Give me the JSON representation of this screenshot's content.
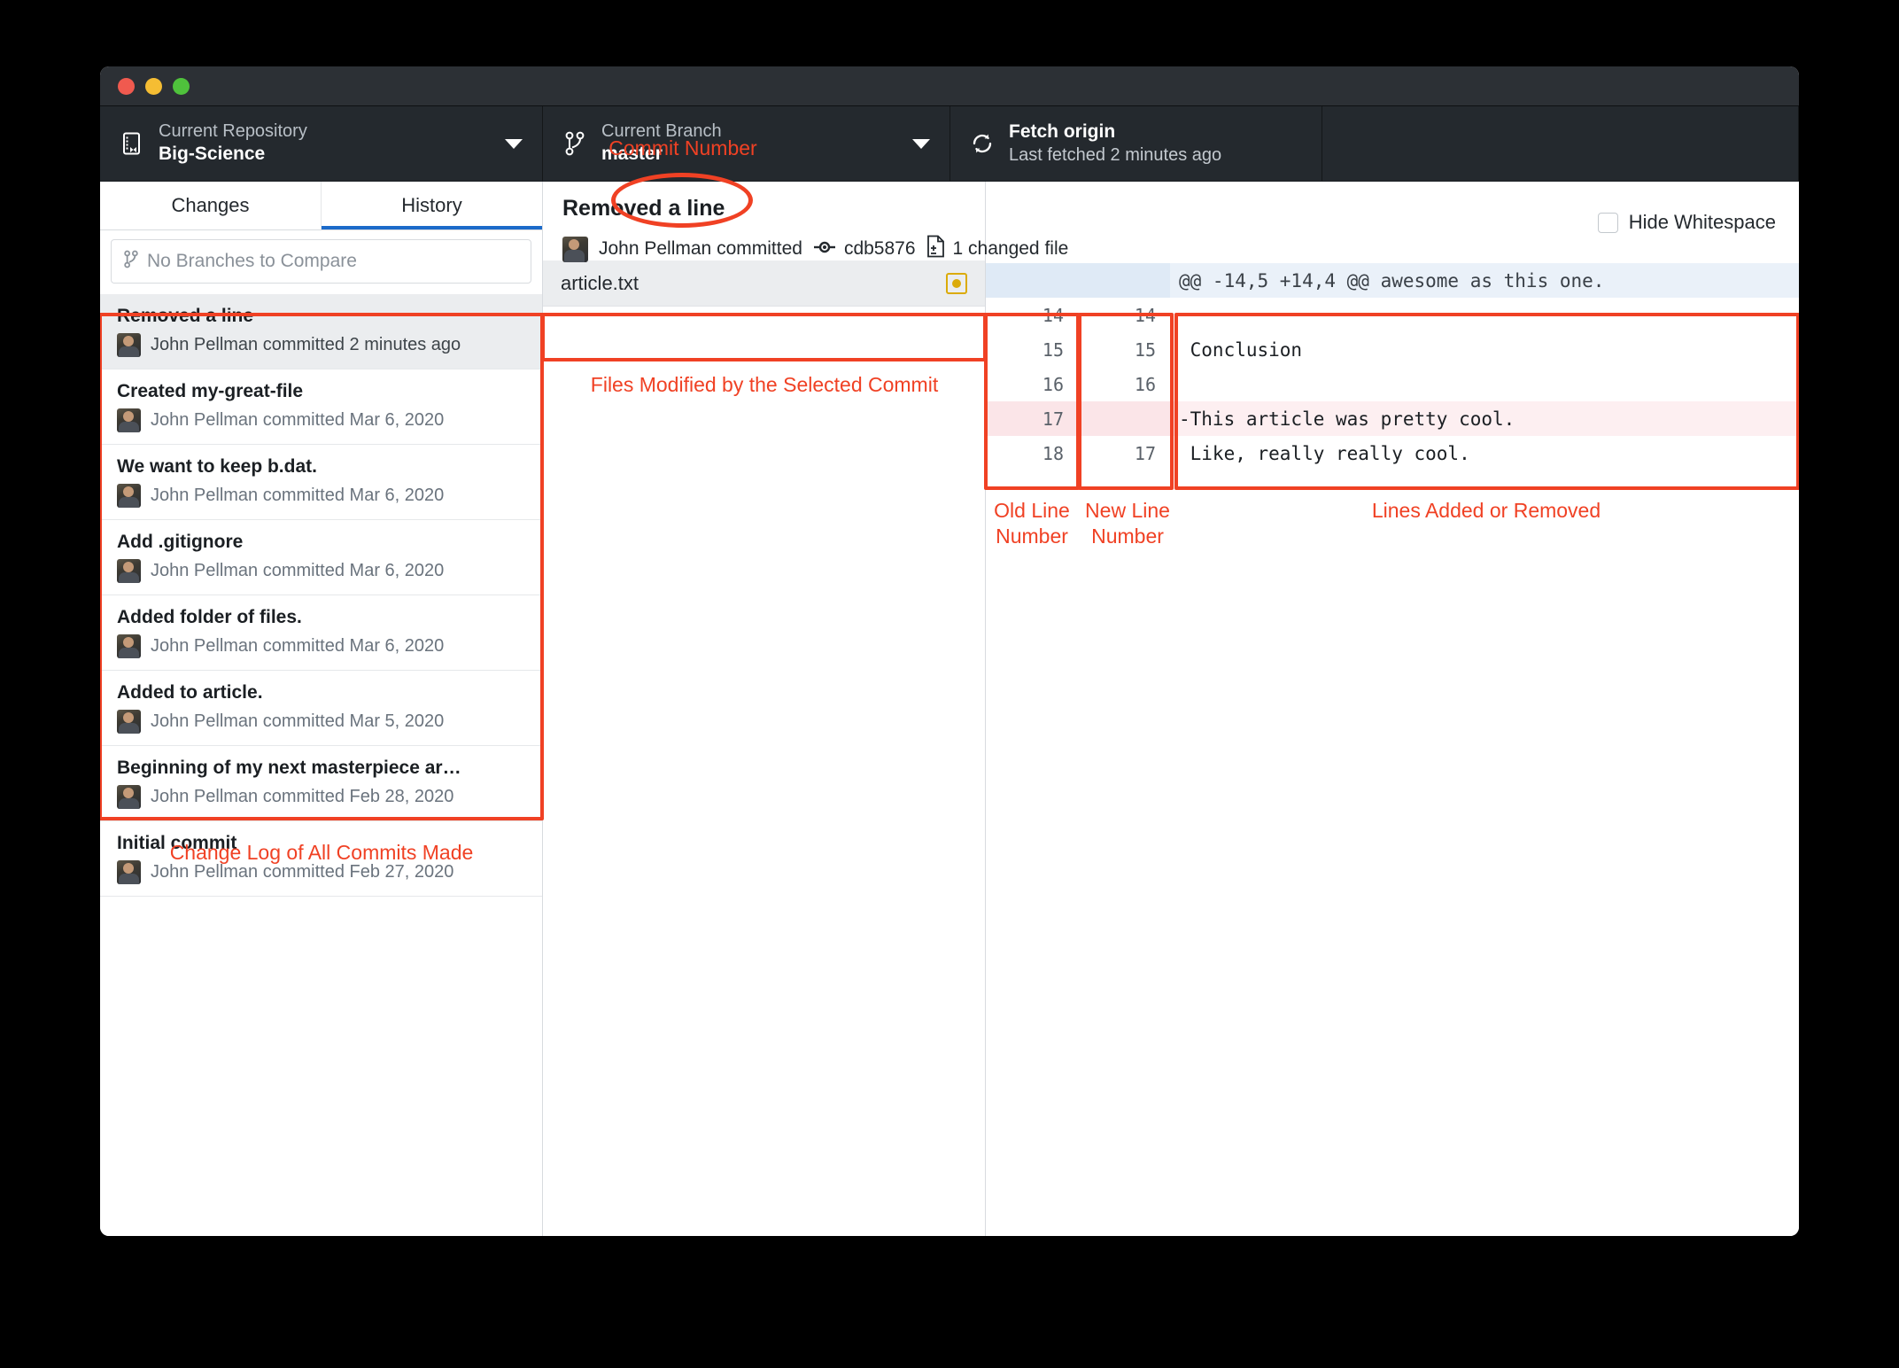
{
  "window": {
    "traffic_lights": [
      "close",
      "minimize",
      "zoom"
    ]
  },
  "toolbar": {
    "repository": {
      "label": "Current Repository",
      "value": "Big-Science",
      "icon": "repo-book-icon"
    },
    "branch": {
      "label": "Current Branch",
      "value": "master",
      "icon": "branch-icon"
    },
    "fetch": {
      "title": "Fetch origin",
      "subtitle": "Last fetched 2 minutes ago",
      "icon": "sync-icon"
    }
  },
  "sidebar": {
    "tabs": [
      {
        "label": "Changes",
        "active": false
      },
      {
        "label": "History",
        "active": true
      }
    ],
    "compare": {
      "placeholder": "No Branches to Compare",
      "icon": "branch-icon"
    },
    "commits": [
      {
        "title": "Removed a line",
        "meta": "John Pellman committed 2 minutes ago",
        "selected": true
      },
      {
        "title": "Created my-great-file",
        "meta": "John Pellman committed Mar 6, 2020",
        "selected": false
      },
      {
        "title": "We want to keep b.dat.",
        "meta": "John Pellman committed Mar 6, 2020",
        "selected": false
      },
      {
        "title": "Add .gitignore",
        "meta": "John Pellman committed Mar 6, 2020",
        "selected": false
      },
      {
        "title": "Added folder of files.",
        "meta": "John Pellman committed Mar 6, 2020",
        "selected": false
      },
      {
        "title": "Added to article.",
        "meta": "John Pellman committed Mar 5, 2020",
        "selected": false
      },
      {
        "title": "Beginning of my next masterpiece ar…",
        "meta": "John Pellman committed Feb 28, 2020",
        "selected": false
      },
      {
        "title": "Initial commit",
        "meta": "John Pellman committed Feb 27, 2020",
        "selected": false
      }
    ]
  },
  "commit_detail": {
    "title": "Removed a line",
    "author_line": "John Pellman committed",
    "sha": "cdb5876",
    "changed_files": "1 changed file",
    "hide_whitespace": {
      "label": "Hide Whitespace",
      "checked": false
    },
    "files": [
      {
        "name": "article.txt",
        "status": "modified",
        "status_color": "#dbab09",
        "selected": true
      }
    ]
  },
  "diff": {
    "lines": [
      {
        "old": "",
        "new": "",
        "text": "@@ -14,5 +14,4 @@ awesome as this one.",
        "type": "hunk"
      },
      {
        "old": "14",
        "new": "14",
        "text": "",
        "type": "context"
      },
      {
        "old": "15",
        "new": "15",
        "text": " Conclusion",
        "type": "context"
      },
      {
        "old": "16",
        "new": "16",
        "text": "",
        "type": "context"
      },
      {
        "old": "17",
        "new": "",
        "text": "-This article was pretty cool.",
        "type": "deleted"
      },
      {
        "old": "18",
        "new": "17",
        "text": " Like, really really cool.",
        "type": "context"
      }
    ]
  },
  "annotations": {
    "color": "#f04124",
    "commit_number": "Commit Number",
    "files_modified": "Files Modified by the Selected Commit",
    "old_line_number": "Old Line\nNumber",
    "new_line_number": "New Line\nNumber",
    "lines_added_removed": "Lines Added or Removed",
    "change_log": "Change Log of All Commits Made"
  }
}
